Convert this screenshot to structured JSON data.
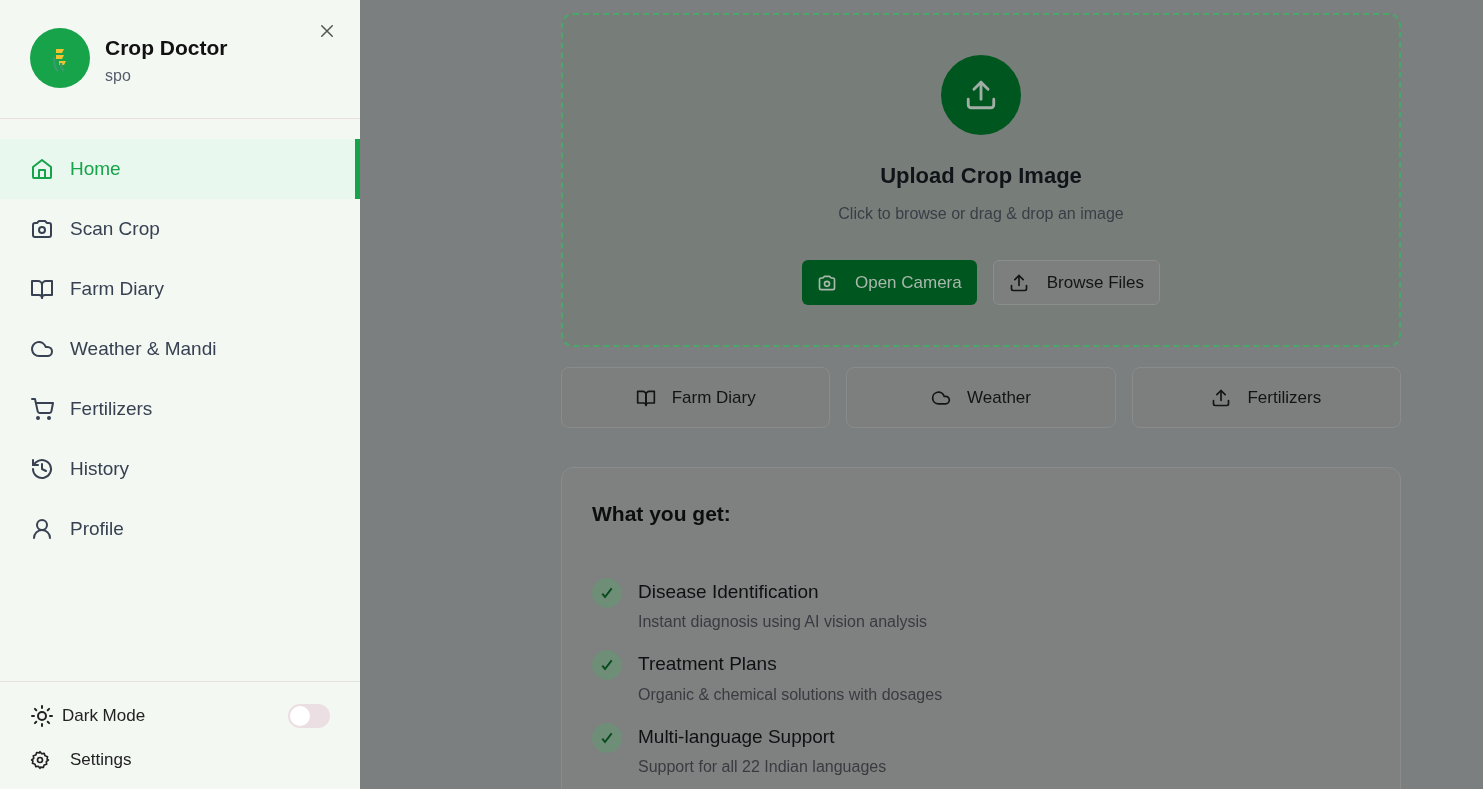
{
  "sidebar": {
    "app_name": "Crop Doctor",
    "subtitle": "spo",
    "items": [
      {
        "label": "Home",
        "selected": true
      },
      {
        "label": "Scan Crop",
        "selected": false
      },
      {
        "label": "Farm Diary",
        "selected": false
      },
      {
        "label": "Weather & Mandi",
        "selected": false
      },
      {
        "label": "Fertilizers",
        "selected": false
      },
      {
        "label": "History",
        "selected": false
      },
      {
        "label": "Profile",
        "selected": false
      }
    ],
    "dark_mode": {
      "label": "Dark Mode",
      "on": false
    },
    "settings": {
      "label": "Settings"
    }
  },
  "upload": {
    "title": "Upload Crop Image",
    "hint": "Click to browse or drag & drop an image",
    "buttons": [
      {
        "label": "Open Camera",
        "kind": "primary"
      },
      {
        "label": "Browse Files",
        "kind": "secondary"
      }
    ]
  },
  "quick_links": [
    {
      "label": "Farm Diary"
    },
    {
      "label": "Weather"
    },
    {
      "label": "Fertilizers"
    }
  ],
  "features": {
    "title": "What you get:",
    "items": [
      {
        "title": "Disease Identification",
        "description": "Instant diagnosis using AI vision analysis"
      },
      {
        "title": "Treatment Plans",
        "description": "Organic & chemical solutions with dosages"
      },
      {
        "title": "Multi-language Support",
        "description": "Support for all 22 Indian languages"
      }
    ]
  }
}
